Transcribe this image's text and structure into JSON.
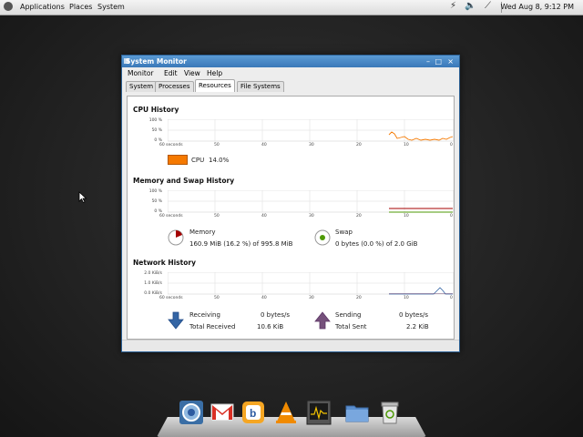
{
  "top_panel": {
    "menus": [
      "Applications",
      "Places",
      "System"
    ],
    "clock": "Wed Aug  8,  9:12 PM"
  },
  "window": {
    "title": "System Monitor",
    "menubar": [
      "Monitor",
      "Edit",
      "View",
      "Help"
    ],
    "tabs": [
      "System",
      "Processes",
      "Resources",
      "File Systems"
    ],
    "active_tab": "Resources",
    "cpu": {
      "title": "CPU History",
      "y_ticks": [
        "100 %",
        "50 %",
        "0 %"
      ],
      "x_ticks": [
        "60 seconds",
        "50",
        "40",
        "30",
        "20",
        "10",
        "0"
      ],
      "legend_label": "CPU",
      "legend_value": "14.0%",
      "color": "#f57900"
    },
    "memory": {
      "title": "Memory and Swap History",
      "y_ticks": [
        "100 %",
        "50 %",
        "0 %"
      ],
      "x_ticks": [
        "60 seconds",
        "50",
        "40",
        "30",
        "20",
        "10",
        "0"
      ],
      "memory_label": "Memory",
      "memory_value": "160.9 MiB (16.2 %) of 995.8 MiB",
      "swap_label": "Swap",
      "swap_value": "0 bytes (0.0 %) of 2.0 GiB",
      "memory_color": "#a40000",
      "swap_color": "#4e9a06"
    },
    "network": {
      "title": "Network History",
      "y_ticks": [
        "2.0 KiB/s",
        "1.0 KiB/s",
        "0.0 KiB/s"
      ],
      "x_ticks": [
        "60 seconds",
        "50",
        "40",
        "30",
        "20",
        "10",
        "0"
      ],
      "receiving_label": "Receiving",
      "receiving_value": "0 bytes/s",
      "total_received_label": "Total Received",
      "total_received_value": "10.6 KiB",
      "sending_label": "Sending",
      "sending_value": "0 bytes/s",
      "total_sent_label": "Total Sent",
      "total_sent_value": "2.2 KiB",
      "receiving_color": "#3465a4",
      "sending_color": "#75507b"
    }
  },
  "dock_icons": [
    "chromium-icon",
    "gmail-icon",
    "blogger-icon",
    "vlc-icon",
    "system-monitor-icon",
    "folder-icon",
    "trash-icon"
  ]
}
